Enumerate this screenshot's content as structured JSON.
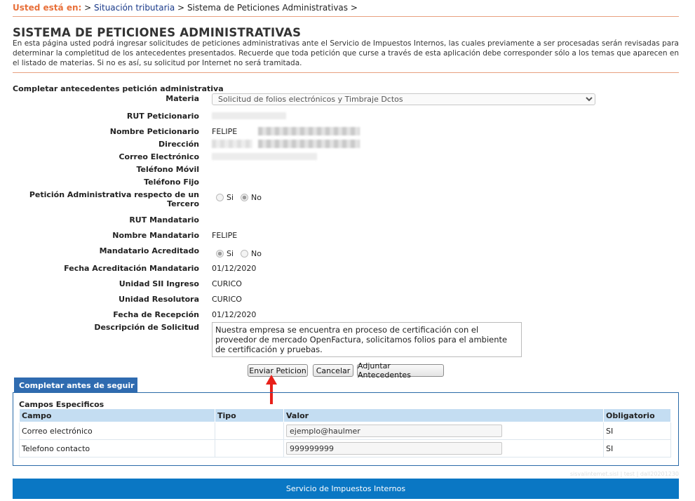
{
  "breadcrumb": {
    "prefix": "Usted está en:",
    "sep1": ">",
    "item1": "Situación tributaria",
    "sep2": ">",
    "item2": "Sistema de Peticiones Administrativas",
    "sep3": ">"
  },
  "page": {
    "title": "SISTEMA DE PETICIONES ADMINISTRATIVAS",
    "intro": "En esta página usted podrá ingresar solicitudes de peticiones administrativas ante el Servicio de Impuestos Internos, las cuales previamente a ser procesadas serán revisadas para determinar la completitud de los antecedentes presentados. Recuerde que toda petición que curse a través de esta aplicación debe corresponder sólo a los temas que aparecen en el listado de materias. Si no es así, su solicitud por Internet no será tramitada."
  },
  "form": {
    "section_title": "Completar antecedentes petición administrativa",
    "materia_label": "Materia",
    "materia_value": "Solicitud de folios electrónicos y Timbraje Dctos",
    "rut_peticionario_label": "RUT Peticionario",
    "nombre_peticionario_label": "Nombre Peticionario",
    "nombre_peticionario_value": "FELIPE",
    "direccion_label": "Dirección",
    "correo_label": "Correo Electrónico",
    "telefono_movil_label": "Teléfono Móvil",
    "telefono_fijo_label": "Teléfono Fijo",
    "tercero_label_line1": "Petición Administrativa respecto de un",
    "tercero_label_line2": "Tercero",
    "radio_si": "Si",
    "radio_no": "No",
    "rut_mandatario_label": "RUT Mandatario",
    "nombre_mandatario_label": "Nombre Mandatario",
    "nombre_mandatario_value": "FELIPE",
    "mandatario_acreditado_label": "Mandatario Acreditado",
    "fecha_acreditacion_label": "Fecha Acreditación Mandatario",
    "fecha_acreditacion_value": "01/12/2020",
    "unidad_ingreso_label": "Unidad SII Ingreso",
    "unidad_ingreso_value": "CURICO",
    "unidad_resolutora_label": "Unidad Resolutora",
    "unidad_resolutora_value": "CURICO",
    "fecha_recepcion_label": "Fecha de Recepción",
    "fecha_recepcion_value": "01/12/2020",
    "descripcion_label": "Descripción de Solicitud",
    "descripcion_value": "Nuestra empresa se encuentra en proceso de certificación con el proveedor de mercado OpenFactura, solicitamos folios para el ambiente de certificación y pruebas."
  },
  "buttons": {
    "enviar": "Enviar Peticion",
    "cancelar": "Cancelar",
    "adjuntar": "Adjuntar Antecedentes"
  },
  "specific": {
    "tab_label": "Completar antes de seguir",
    "title": "Campos Especificos",
    "headers": [
      "Campo",
      "Tipo",
      "Valor",
      "Obligatorio"
    ],
    "rows": [
      {
        "campo": "Correo electrónico",
        "tipo": "",
        "valor": "ejemplo@haulmer",
        "obligatorio": "SI"
      },
      {
        "campo": "Telefono contacto",
        "tipo": "",
        "valor": "999999999",
        "obligatorio": "SI"
      }
    ]
  },
  "footer": {
    "text": "Servicio de Impuestos Internos",
    "faint": "sisvalintemet.sisI | test | dall20201230"
  },
  "colors": {
    "accent_orange": "#e8703a",
    "link_blue": "#1a3a8a",
    "footer_blue": "#0a77c4",
    "tab_blue": "#2f6bb0",
    "header_row": "#c4ddf2",
    "annotation_arrow": "#e8201a"
  },
  "icons": [
    "arrow-up-icon",
    "chevron-down-icon",
    "resize-grip-icon"
  ]
}
